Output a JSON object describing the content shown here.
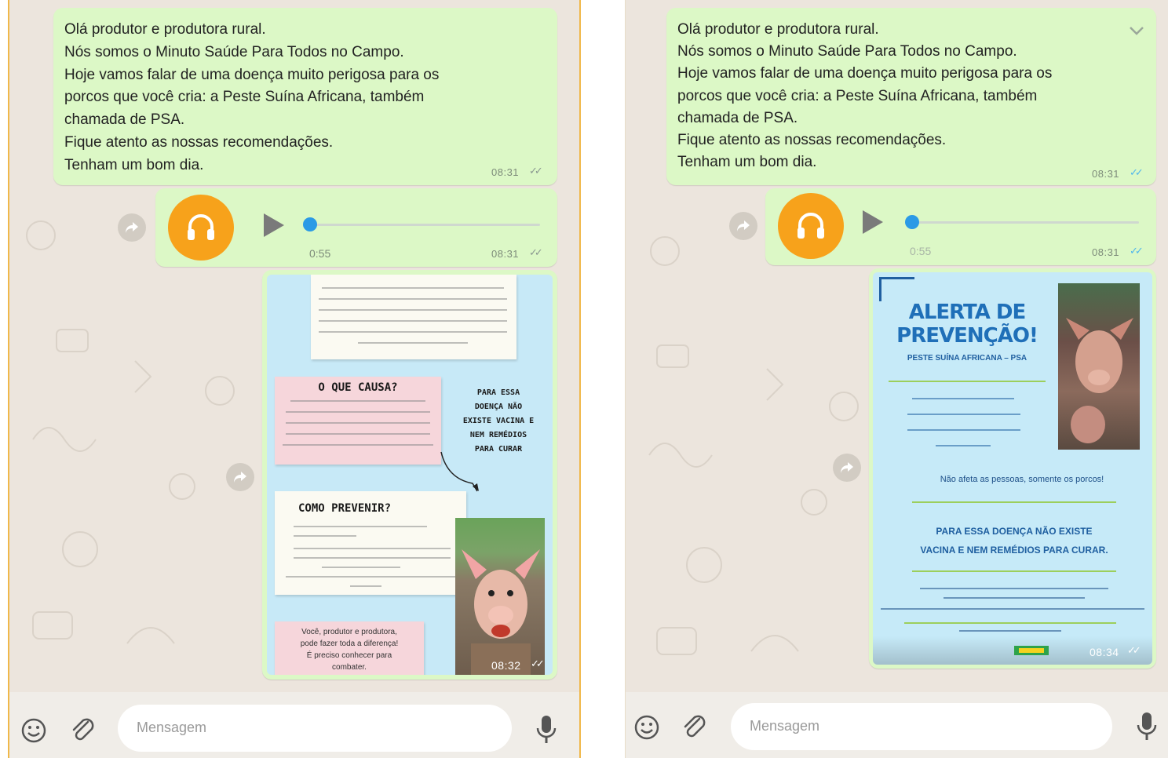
{
  "left": {
    "text_message": {
      "text": "Olá produtor e produtora rural.\nNós somos o Minuto Saúde Para Todos no Campo.\nHoje vamos falar de uma doença muito perigosa para os\nporcos que você cria: a Peste Suína Africana, também\nchamada de PSA.\nFique atento as nossas recomendações.\nTenham um bom dia.",
      "time": "08:31"
    },
    "audio_message": {
      "duration": "0:55",
      "time": "08:31",
      "progress": 0.0
    },
    "image_message": {
      "time": "08:32",
      "card_causa_title": "O QUE CAUSA?",
      "card_vacina_text": "PARA ESSA\nDOENÇA NÃO\nEXISTE VACINA E\nNEM REMÉDIOS\nPARA CURAR",
      "card_previnir_title": "COMO PREVENIR?",
      "card_produtor_text": "Você, produtor e produtora,\npode fazer toda a diferença!\nÉ preciso conhecer para\ncombater."
    },
    "composer": {
      "placeholder": "Mensagem"
    }
  },
  "right": {
    "text_message": {
      "text": "Olá produtor e produtora rural.\nNós somos o Minuto Saúde Para Todos no Campo.\nHoje vamos falar de uma doença muito perigosa para os\nporcos que você cria: a Peste Suína Africana, também\nchamada de PSA.\nFique atento as nossas recomendações.\nTenham um bom dia.",
      "time": "08:31"
    },
    "audio_message": {
      "duration": "0:55",
      "time": "08:31",
      "progress": 0.0
    },
    "image_message": {
      "time": "08:34",
      "poster_title_line1": "ALERTA DE",
      "poster_title_line2": "PREVENÇÃO!",
      "poster_subtitle": "PESTE SUÍNA AFRICANA – PSA",
      "poster_text_2": "Não afeta as pessoas, somente os porcos!",
      "poster_text_3": "PARA ESSA DOENÇA NÃO EXISTE\nVACINA E NEM REMÉDIOS PARA CURAR."
    },
    "composer": {
      "placeholder": "Mensagem"
    }
  },
  "colors": {
    "chat_bg": "#ECE5DD",
    "outgoing_bubble": "#DCF8C6",
    "audio_avatar": "#F7A21B",
    "audio_progress": "#2B9AE6",
    "read_ticks": "#4FB6EC"
  },
  "icons": [
    "forward-icon",
    "headphones-icon",
    "play-icon",
    "emoji-icon",
    "attach-icon",
    "microphone-icon",
    "chevron-down-icon",
    "double-check-icon"
  ]
}
